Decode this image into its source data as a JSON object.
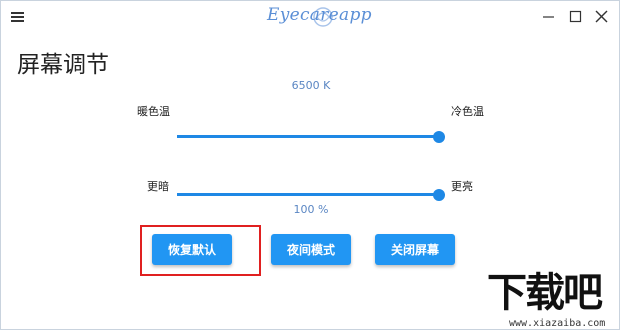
{
  "app": {
    "logo_text": "Eyecareapp"
  },
  "window_controls": {
    "minimize_icon": "minimize-icon",
    "maximize_icon": "maximize-icon",
    "close_icon": "close-icon"
  },
  "page": {
    "title": "屏幕调节"
  },
  "color_temperature": {
    "value_text": "6500 K",
    "min_label": "暖色温",
    "max_label": "冷色温",
    "level": 1.0
  },
  "brightness": {
    "value_text": "100 %",
    "min_label": "更暗",
    "max_label": "更亮",
    "level": 1.0
  },
  "buttons": {
    "reset": "恢复默认",
    "night_mode": "夜间模式",
    "screen_off": "关闭屏幕"
  },
  "watermark": {
    "big": "下载吧",
    "small": "www.xiazaiba.com"
  },
  "colors": {
    "accent": "#2196f3",
    "highlight": "#e02020",
    "logo": "#5b8fd6"
  }
}
